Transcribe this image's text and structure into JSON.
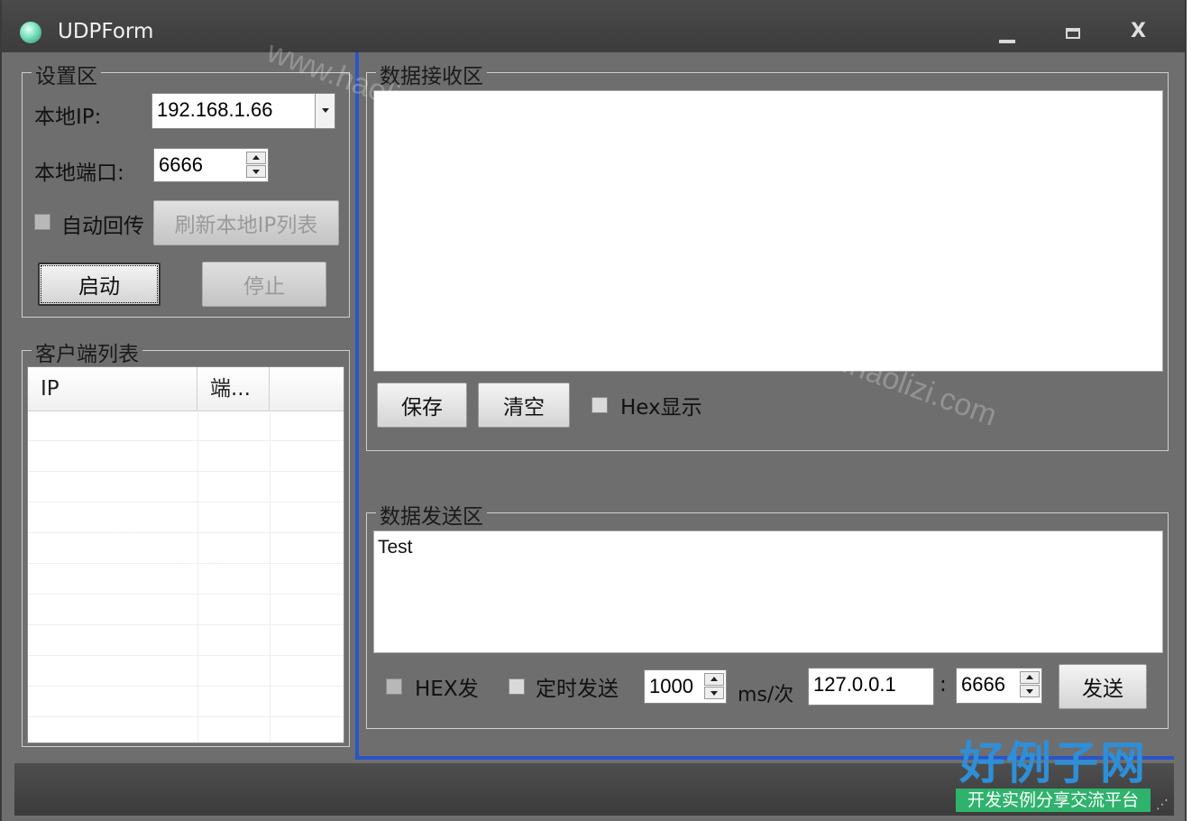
{
  "window": {
    "title": "UDPForm"
  },
  "settings": {
    "group_title": "设置区",
    "local_ip_label": "本地IP:",
    "local_ip_value": "192.168.1.66",
    "local_port_label": "本地端口:",
    "local_port_value": "6666",
    "auto_echo_label": "自动回传",
    "refresh_ip_label": "刷新本地IP列表",
    "start_label": "启动",
    "stop_label": "停止"
  },
  "clients": {
    "group_title": "客户端列表",
    "columns": [
      "IP",
      "端..."
    ]
  },
  "receive": {
    "group_title": "数据接收区",
    "content": "",
    "save_label": "保存",
    "clear_label": "清空",
    "hex_display_label": "Hex显示"
  },
  "send": {
    "group_title": "数据发送区",
    "content": "Test",
    "hex_send_label": "HEX发",
    "timed_send_label": "定时发送",
    "interval_value": "1000",
    "interval_unit": "ms/次",
    "target_ip": "127.0.0.1",
    "colon": ":",
    "target_port": "6666",
    "send_label": "发送"
  },
  "watermark": {
    "big": "好例子网",
    "small": "开发实例分享交流平台",
    "faint": "www.haolizi.com"
  },
  "colors": {
    "accent": "#2a55c8",
    "background": "#6e6e6e"
  }
}
